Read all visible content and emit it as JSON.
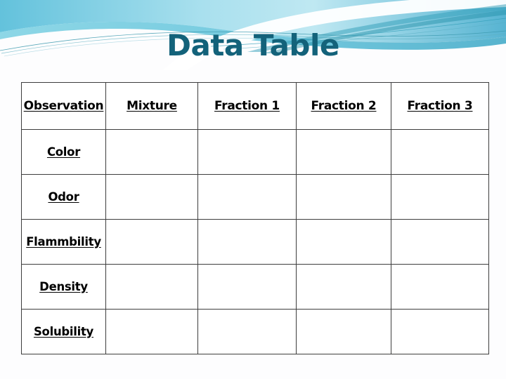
{
  "slide": {
    "title": "Data Table",
    "title_color": "#13627a",
    "background_color": "#fdfdfe"
  },
  "banner": {
    "name": "decorative-wave-banner",
    "gradient_left": "#6ec6de",
    "gradient_mid": "#b9e6f0",
    "gradient_right": "#5fb8d4",
    "accent_teal": "#1f8ea6",
    "accent_light": "#8fd8e8",
    "swoosh_color": "#ffffff"
  },
  "table": {
    "name": "data-table",
    "headers": [
      "Observation",
      "Mixture",
      "Fraction 1",
      "Fraction 2",
      "Fraction 3"
    ],
    "rows": [
      {
        "label": "Color",
        "cells": [
          "",
          "",
          "",
          ""
        ]
      },
      {
        "label": "Odor",
        "cells": [
          "",
          "",
          "",
          ""
        ]
      },
      {
        "label": "Flammbility",
        "cells": [
          "",
          "",
          "",
          ""
        ]
      },
      {
        "label": "Density",
        "cells": [
          "",
          "",
          "",
          ""
        ]
      },
      {
        "label": "Solubility",
        "cells": [
          "",
          "",
          "",
          ""
        ]
      }
    ],
    "border_color": "#3d3d3d",
    "cell_background": "#ffffff",
    "text_color": "#000000"
  }
}
